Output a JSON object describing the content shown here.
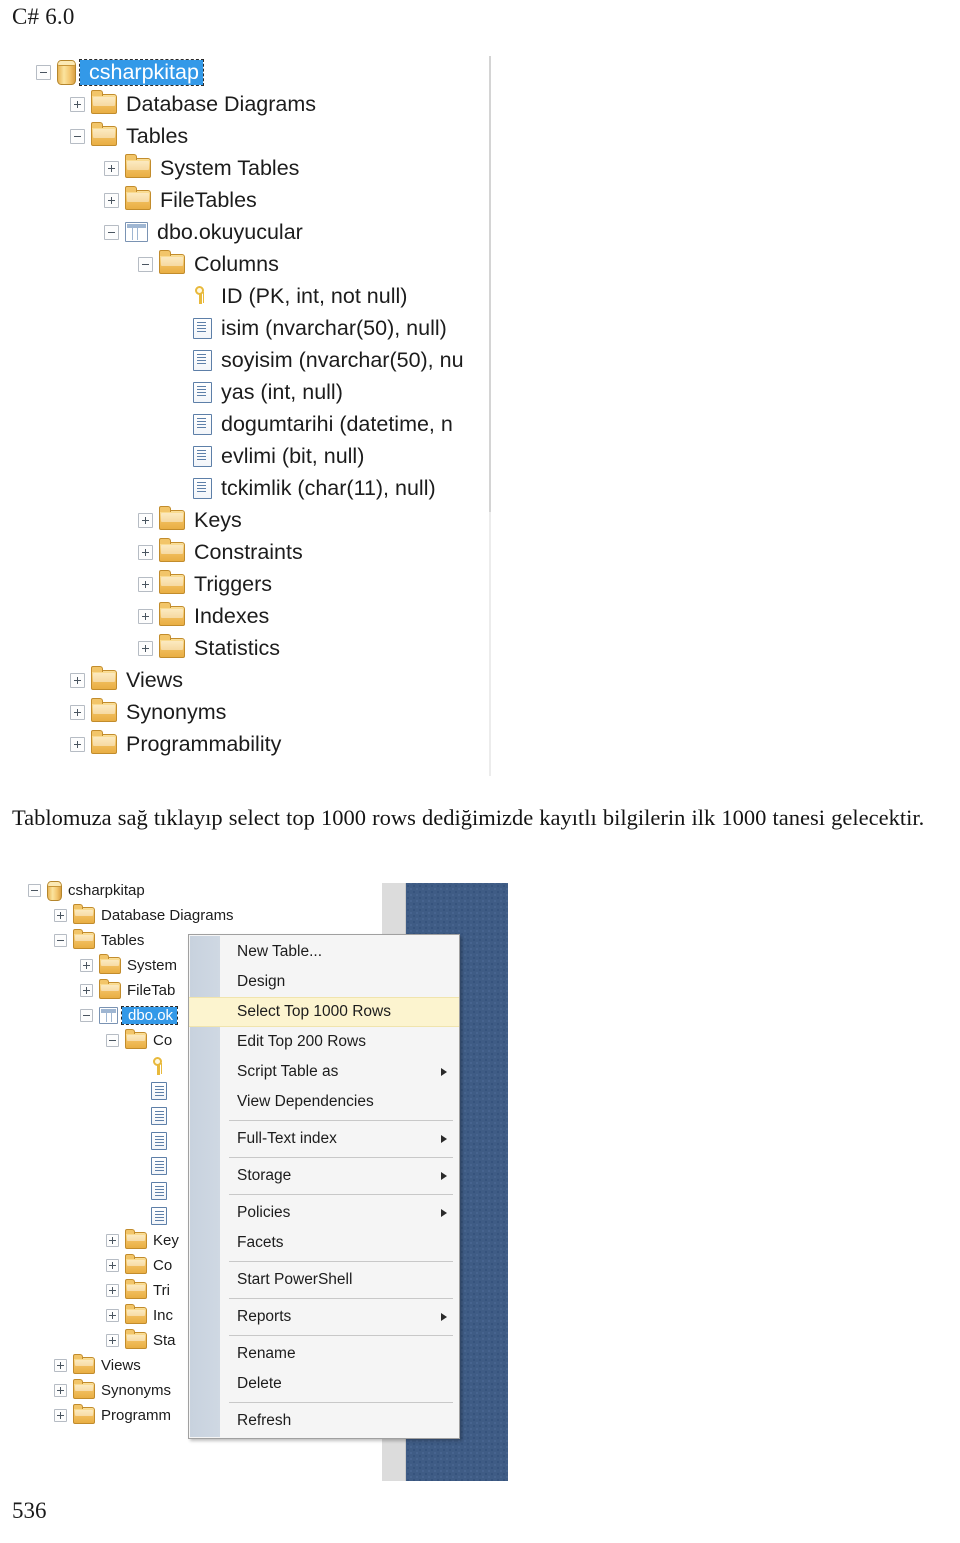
{
  "page": {
    "header": "C# 6.0",
    "number": "536",
    "paragraph": "Tablomuza sağ tıklayıp select top 1000 rows dediğimizde kayıtlı bilgilerin ilk 1000 tanesi gelecektir."
  },
  "object_explorer_top": {
    "nodes": [
      {
        "label": "csharpkitap",
        "icon": "database-icon",
        "expander": "minus",
        "indent": 0,
        "selected": true
      },
      {
        "label": "Database Diagrams",
        "icon": "folder-icon",
        "expander": "plus",
        "indent": 1,
        "selected": false
      },
      {
        "label": "Tables",
        "icon": "folder-icon",
        "expander": "minus",
        "indent": 1,
        "selected": false
      },
      {
        "label": "System Tables",
        "icon": "folder-icon",
        "expander": "plus",
        "indent": 2,
        "selected": false
      },
      {
        "label": "FileTables",
        "icon": "folder-icon",
        "expander": "plus",
        "indent": 2,
        "selected": false
      },
      {
        "label": "dbo.okuyucular",
        "icon": "table-icon",
        "expander": "minus",
        "indent": 2,
        "selected": false
      },
      {
        "label": "Columns",
        "icon": "folder-icon",
        "expander": "minus",
        "indent": 3,
        "selected": false
      },
      {
        "label": "ID (PK, int, not null)",
        "icon": "primary-key-icon",
        "expander": "none",
        "indent": 4,
        "selected": false
      },
      {
        "label": "isim (nvarchar(50), null)",
        "icon": "column-icon",
        "expander": "none",
        "indent": 4,
        "selected": false
      },
      {
        "label": "soyisim (nvarchar(50), nu",
        "icon": "column-icon",
        "expander": "none",
        "indent": 4,
        "selected": false
      },
      {
        "label": "yas (int, null)",
        "icon": "column-icon",
        "expander": "none",
        "indent": 4,
        "selected": false
      },
      {
        "label": "dogumtarihi (datetime, n",
        "icon": "column-icon",
        "expander": "none",
        "indent": 4,
        "selected": false
      },
      {
        "label": "evlimi (bit, null)",
        "icon": "column-icon",
        "expander": "none",
        "indent": 4,
        "selected": false
      },
      {
        "label": "tckimlik (char(11), null)",
        "icon": "column-icon",
        "expander": "none",
        "indent": 4,
        "selected": false
      },
      {
        "label": "Keys",
        "icon": "folder-icon",
        "expander": "plus",
        "indent": 3,
        "selected": false
      },
      {
        "label": "Constraints",
        "icon": "folder-icon",
        "expander": "plus",
        "indent": 3,
        "selected": false
      },
      {
        "label": "Triggers",
        "icon": "folder-icon",
        "expander": "plus",
        "indent": 3,
        "selected": false
      },
      {
        "label": "Indexes",
        "icon": "folder-icon",
        "expander": "plus",
        "indent": 3,
        "selected": false
      },
      {
        "label": "Statistics",
        "icon": "folder-icon",
        "expander": "plus",
        "indent": 3,
        "selected": false
      },
      {
        "label": "Views",
        "icon": "folder-icon",
        "expander": "plus",
        "indent": 1,
        "selected": false
      },
      {
        "label": "Synonyms",
        "icon": "folder-icon",
        "expander": "plus",
        "indent": 1,
        "selected": false
      },
      {
        "label": "Programmability",
        "icon": "folder-icon",
        "expander": "plus",
        "indent": 1,
        "selected": false
      }
    ]
  },
  "object_explorer_bottom": {
    "nodes": [
      {
        "label": "csharpkitap",
        "icon": "database-icon",
        "expander": "minus",
        "indent": 0,
        "selected": false
      },
      {
        "label": "Database Diagrams",
        "icon": "folder-icon",
        "expander": "plus",
        "indent": 1,
        "selected": false
      },
      {
        "label": "Tables",
        "icon": "folder-icon",
        "expander": "minus",
        "indent": 1,
        "selected": false
      },
      {
        "label": "System",
        "icon": "folder-icon",
        "expander": "plus",
        "indent": 2,
        "selected": false
      },
      {
        "label": "FileTab",
        "icon": "folder-icon",
        "expander": "plus",
        "indent": 2,
        "selected": false
      },
      {
        "label": "dbo.ok",
        "icon": "table-icon",
        "expander": "minus",
        "indent": 2,
        "selected": true
      },
      {
        "label": "Co",
        "icon": "folder-icon",
        "expander": "minus",
        "indent": 3,
        "selected": false
      },
      {
        "label": "",
        "icon": "primary-key-icon",
        "expander": "none",
        "indent": 4,
        "selected": false
      },
      {
        "label": "",
        "icon": "column-icon",
        "expander": "none",
        "indent": 4,
        "selected": false
      },
      {
        "label": "",
        "icon": "column-icon",
        "expander": "none",
        "indent": 4,
        "selected": false
      },
      {
        "label": "",
        "icon": "column-icon",
        "expander": "none",
        "indent": 4,
        "selected": false
      },
      {
        "label": "",
        "icon": "column-icon",
        "expander": "none",
        "indent": 4,
        "selected": false
      },
      {
        "label": "",
        "icon": "column-icon",
        "expander": "none",
        "indent": 4,
        "selected": false
      },
      {
        "label": "",
        "icon": "column-icon",
        "expander": "none",
        "indent": 4,
        "selected": false
      },
      {
        "label": "Key",
        "icon": "folder-icon",
        "expander": "plus",
        "indent": 3,
        "selected": false
      },
      {
        "label": "Co",
        "icon": "folder-icon",
        "expander": "plus",
        "indent": 3,
        "selected": false
      },
      {
        "label": "Tri",
        "icon": "folder-icon",
        "expander": "plus",
        "indent": 3,
        "selected": false
      },
      {
        "label": "Inc",
        "icon": "folder-icon",
        "expander": "plus",
        "indent": 3,
        "selected": false
      },
      {
        "label": "Sta",
        "icon": "folder-icon",
        "expander": "plus",
        "indent": 3,
        "selected": false
      },
      {
        "label": "Views",
        "icon": "folder-icon",
        "expander": "plus",
        "indent": 1,
        "selected": false
      },
      {
        "label": "Synonyms",
        "icon": "folder-icon",
        "expander": "plus",
        "indent": 1,
        "selected": false
      },
      {
        "label": "Programm",
        "icon": "folder-icon",
        "expander": "plus",
        "indent": 1,
        "selected": false
      }
    ]
  },
  "context_menu": {
    "items": [
      {
        "label": "New Table...",
        "submenu": false,
        "highlighted": false,
        "separator_after": false
      },
      {
        "label": "Design",
        "submenu": false,
        "highlighted": false,
        "separator_after": false
      },
      {
        "label": "Select Top 1000 Rows",
        "submenu": false,
        "highlighted": true,
        "separator_after": false
      },
      {
        "label": "Edit Top 200 Rows",
        "submenu": false,
        "highlighted": false,
        "separator_after": false
      },
      {
        "label": "Script Table as",
        "submenu": true,
        "highlighted": false,
        "separator_after": false
      },
      {
        "label": "View Dependencies",
        "submenu": false,
        "highlighted": false,
        "separator_after": true
      },
      {
        "label": "Full-Text index",
        "submenu": true,
        "highlighted": false,
        "separator_after": true
      },
      {
        "label": "Storage",
        "submenu": true,
        "highlighted": false,
        "separator_after": true
      },
      {
        "label": "Policies",
        "submenu": true,
        "highlighted": false,
        "separator_after": false
      },
      {
        "label": "Facets",
        "submenu": false,
        "highlighted": false,
        "separator_after": true
      },
      {
        "label": "Start PowerShell",
        "submenu": false,
        "highlighted": false,
        "separator_after": true
      },
      {
        "label": "Reports",
        "submenu": true,
        "highlighted": false,
        "separator_after": true
      },
      {
        "label": "Rename",
        "submenu": false,
        "highlighted": false,
        "separator_after": false
      },
      {
        "label": "Delete",
        "submenu": false,
        "highlighted": false,
        "separator_after": true
      },
      {
        "label": "Refresh",
        "submenu": false,
        "highlighted": false,
        "separator_after": false
      }
    ]
  },
  "colors": {
    "selection_blue": "#3399e8",
    "menu_highlight": "#fcf4cf",
    "desktop_blue": "#3f5c85",
    "folder_gold": "#f0bd5c"
  }
}
